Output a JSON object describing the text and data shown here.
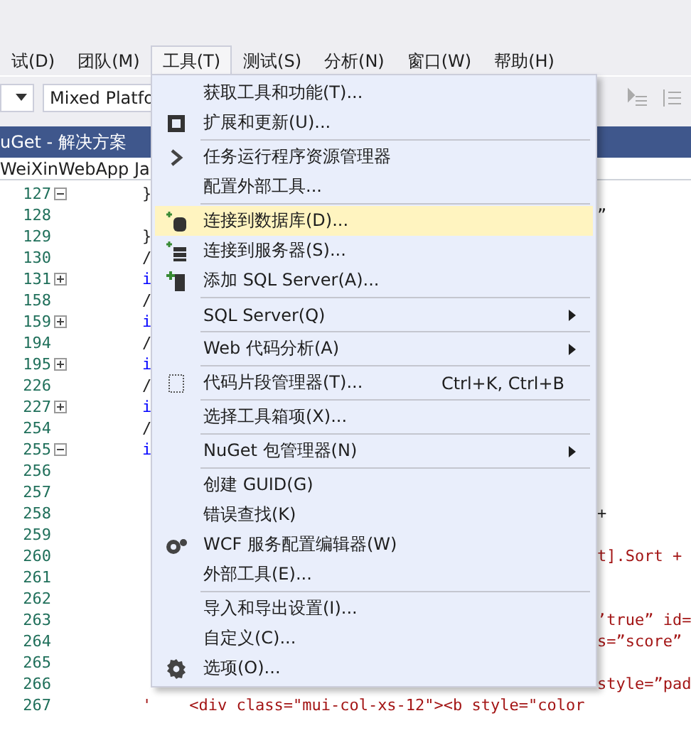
{
  "menubar": [
    {
      "label": "试(D)",
      "selected": false
    },
    {
      "label": "团队(M)",
      "selected": false
    },
    {
      "label": "工具(T)",
      "selected": true
    },
    {
      "label": "测试(S)",
      "selected": false
    },
    {
      "label": "分析(N)",
      "selected": false
    },
    {
      "label": "窗口(W)",
      "selected": false
    },
    {
      "label": "帮助(H)",
      "selected": false
    }
  ],
  "toolbar": {
    "platform_combo": "Mixed Platfo"
  },
  "panel_title": "uGet - 解决方案",
  "document_tab": "WeiXinWebApp Ja",
  "code_rows": [
    {
      "number": "127",
      "expanded": true,
      "code": "}"
    },
    {
      "number": "128",
      "far": "”"
    },
    {
      "number": "129",
      "code": "}"
    },
    {
      "number": "130",
      "code": "/"
    },
    {
      "number": "131",
      "expanded": false,
      "code": "i"
    },
    {
      "number": "158",
      "code": "/"
    },
    {
      "number": "159",
      "expanded": false,
      "code": "i"
    },
    {
      "number": "194",
      "code": "/"
    },
    {
      "number": "195",
      "expanded": false,
      "code": "i"
    },
    {
      "number": "226",
      "code": "/"
    },
    {
      "number": "227",
      "expanded": false,
      "code": "i"
    },
    {
      "number": "254",
      "code": "/"
    },
    {
      "number": "255",
      "expanded": true,
      "code": "i"
    },
    {
      "number": "256"
    },
    {
      "number": "257"
    },
    {
      "number": "258",
      "far": "+"
    },
    {
      "number": "259"
    },
    {
      "number": "260",
      "far": "t].Sort +"
    },
    {
      "number": "261"
    },
    {
      "number": "262"
    },
    {
      "number": "263",
      "far": "’true” id="
    },
    {
      "number": "264",
      "far": "s=”score”"
    },
    {
      "number": "265"
    },
    {
      "number": "266",
      "far": "style=”pad"
    },
    {
      "number": "267",
      "mid": "'    <div class=\"mui-col-xs-12\"><b style=\"color"
    }
  ],
  "menu": [
    {
      "kind": "command",
      "label": "获取工具和功能(T)...",
      "selected": false,
      "submenu": false
    },
    {
      "kind": "command",
      "label": "扩展和更新(U)...",
      "selected": false,
      "submenu": false
    },
    {
      "kind": "separator"
    },
    {
      "kind": "command",
      "label": "任务运行程序资源管理器",
      "selected": false,
      "submenu": false
    },
    {
      "kind": "command",
      "label": "配置外部工具...",
      "selected": false,
      "submenu": false
    },
    {
      "kind": "separator"
    },
    {
      "kind": "command",
      "label": "连接到数据库(D)...",
      "selected": true,
      "submenu": false
    },
    {
      "kind": "command",
      "label": "连接到服务器(S)...",
      "selected": false,
      "submenu": false
    },
    {
      "kind": "command",
      "label": "添加 SQL Server(A)...",
      "selected": false,
      "submenu": false
    },
    {
      "kind": "separator"
    },
    {
      "kind": "command",
      "label": "SQL Server(Q)",
      "selected": false,
      "submenu": true
    },
    {
      "kind": "separator"
    },
    {
      "kind": "command",
      "label": "Web 代码分析(A)",
      "selected": false,
      "submenu": true
    },
    {
      "kind": "separator"
    },
    {
      "kind": "command",
      "label": "代码片段管理器(T)...",
      "shortcut": "Ctrl+K, Ctrl+B",
      "selected": false,
      "submenu": false
    },
    {
      "kind": "separator"
    },
    {
      "kind": "command",
      "label": "选择工具箱项(X)...",
      "selected": false,
      "submenu": false
    },
    {
      "kind": "separator"
    },
    {
      "kind": "command",
      "label": "NuGet 包管理器(N)",
      "selected": false,
      "submenu": true
    },
    {
      "kind": "separator"
    },
    {
      "kind": "command",
      "label": "创建 GUID(G)",
      "selected": false,
      "submenu": false
    },
    {
      "kind": "command",
      "label": "错误查找(K)",
      "selected": false,
      "submenu": false
    },
    {
      "kind": "command",
      "label": "WCF 服务配置编辑器(W)",
      "selected": false,
      "submenu": false
    },
    {
      "kind": "command",
      "label": "外部工具(E)...",
      "selected": false,
      "submenu": false
    },
    {
      "kind": "separator"
    },
    {
      "kind": "command",
      "label": "导入和导出设置(I)...",
      "selected": false,
      "submenu": false
    },
    {
      "kind": "command",
      "label": "自定义(C)...",
      "selected": false,
      "submenu": false
    },
    {
      "kind": "command",
      "label": "选项(O)...",
      "selected": false,
      "submenu": false
    }
  ]
}
